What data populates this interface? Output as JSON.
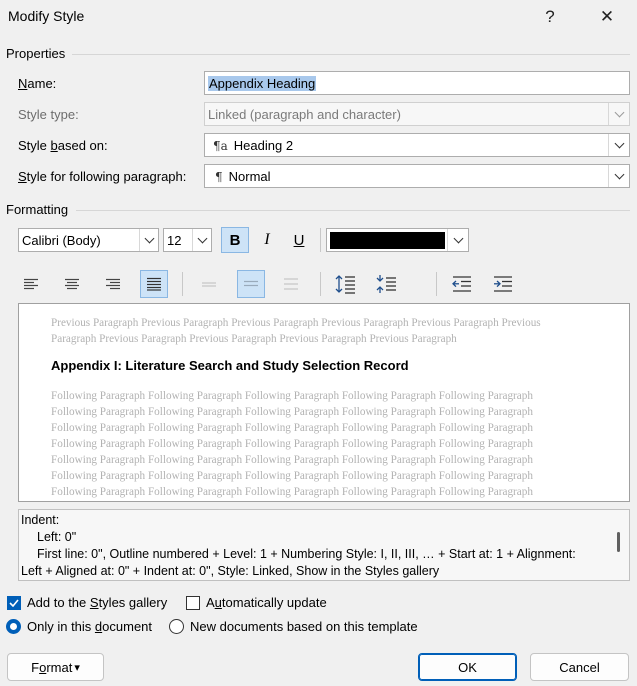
{
  "dialog": {
    "title": "Modify Style",
    "help_glyph": "?",
    "close_glyph": "✕"
  },
  "properties": {
    "section_label": "Properties",
    "name": {
      "label_pre": "",
      "label_acc": "N",
      "label_post": "ame:",
      "value": "Appendix Heading"
    },
    "style_type": {
      "label": "Style type:",
      "value": "Linked (paragraph and character)"
    },
    "based_on": {
      "label_pre": "Style ",
      "label_acc": "b",
      "label_post": "ased on:",
      "icon_glyph": "¶a",
      "value": "Heading 2"
    },
    "following": {
      "label_pre": "",
      "label_acc": "S",
      "label_post": "tyle for following paragraph:",
      "icon_glyph": "¶",
      "value": "Normal"
    }
  },
  "formatting": {
    "section_label": "Formatting",
    "font": "Calibri (Body)",
    "size": "12",
    "bold": "B",
    "italic": "I",
    "underline": "U",
    "font_color": "#000000"
  },
  "preview": {
    "previous_lines": [
      "Previous Paragraph Previous Paragraph Previous Paragraph Previous Paragraph Previous Paragraph Previous",
      "Paragraph Previous Paragraph Previous Paragraph Previous Paragraph Previous Paragraph"
    ],
    "heading": "Appendix I:  Literature Search and Study Selection Record",
    "following_lines": [
      "Following Paragraph Following Paragraph Following Paragraph Following Paragraph Following Paragraph",
      "Following Paragraph Following Paragraph Following Paragraph Following Paragraph Following Paragraph",
      "Following Paragraph Following Paragraph Following Paragraph Following Paragraph Following Paragraph",
      "Following Paragraph Following Paragraph Following Paragraph Following Paragraph Following Paragraph",
      "Following Paragraph Following Paragraph Following Paragraph Following Paragraph Following Paragraph",
      "Following Paragraph Following Paragraph Following Paragraph Following Paragraph Following Paragraph",
      "Following Paragraph Following Paragraph Following Paragraph Following Paragraph Following Paragraph"
    ]
  },
  "description": {
    "lines": [
      "Indent:",
      "    Left:  0\"",
      "    First line:  0\", Outline numbered + Level: 1 + Numbering Style: I, II, III, … + Start at: 1 + Alignment:",
      "Left + Aligned at:  0\" + Indent at:  0\", Style: Linked, Show in the Styles gallery"
    ]
  },
  "options": {
    "add_to_gallery": {
      "label_pre": "Add to the ",
      "label_acc": "S",
      "label_post": "tyles gallery",
      "checked": true
    },
    "auto_update": {
      "label_pre": "A",
      "label_acc": "u",
      "label_post": "tomatically update",
      "checked": false
    },
    "only_this_doc": {
      "label_pre": "Only in this ",
      "label_acc": "d",
      "label_post": "ocument",
      "selected": true
    },
    "new_docs": {
      "label": "New documents based on this template",
      "selected": false
    }
  },
  "buttons": {
    "format_pre": "F",
    "format_acc": "o",
    "format_post": "rmat",
    "format_caret": "▾",
    "ok": "OK",
    "cancel": "Cancel"
  },
  "colors": {
    "accent": "#005fb8",
    "selection": "#a8c8ec",
    "active_tool": "#cde3f7"
  }
}
